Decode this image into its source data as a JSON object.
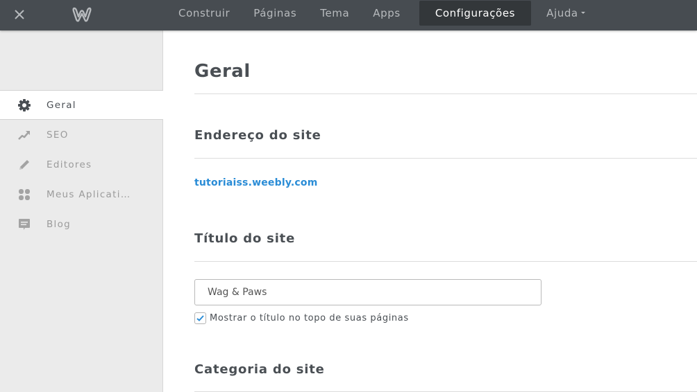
{
  "topbar": {
    "close_icon": "close-icon",
    "logo_icon": "weebly-logo-icon",
    "nav": [
      {
        "label": "Construir",
        "active": false
      },
      {
        "label": "Páginas",
        "active": false
      },
      {
        "label": "Tema",
        "active": false
      },
      {
        "label": "Apps",
        "active": false
      },
      {
        "label": "Configurações",
        "active": true
      },
      {
        "label": "Ajuda",
        "active": false,
        "has_dropdown": true
      }
    ]
  },
  "sidebar": {
    "items": [
      {
        "label": "Geral",
        "icon": "gear-icon",
        "active": true
      },
      {
        "label": "SEO",
        "icon": "trending-up-icon",
        "active": false
      },
      {
        "label": "Editores",
        "icon": "pencil-icon",
        "active": false
      },
      {
        "label": "Meus Aplicati…",
        "icon": "apps-grid-icon",
        "active": false
      },
      {
        "label": "Blog",
        "icon": "comment-icon",
        "active": false
      }
    ]
  },
  "main": {
    "title": "Geral",
    "site_address": {
      "heading": "Endereço do site",
      "url": "tutoriaiss.weebly.com"
    },
    "site_title": {
      "heading": "Título do site",
      "value": "Wag & Paws",
      "show_title_label": "Mostrar o título no topo de suas páginas",
      "show_title_checked": true
    },
    "site_category": {
      "heading": "Categoria do site"
    }
  },
  "colors": {
    "topbar_bg": "#474c51",
    "active_tab_bg": "#33373a",
    "link": "#2a8cd6",
    "sidebar_bg": "#ebebeb"
  }
}
